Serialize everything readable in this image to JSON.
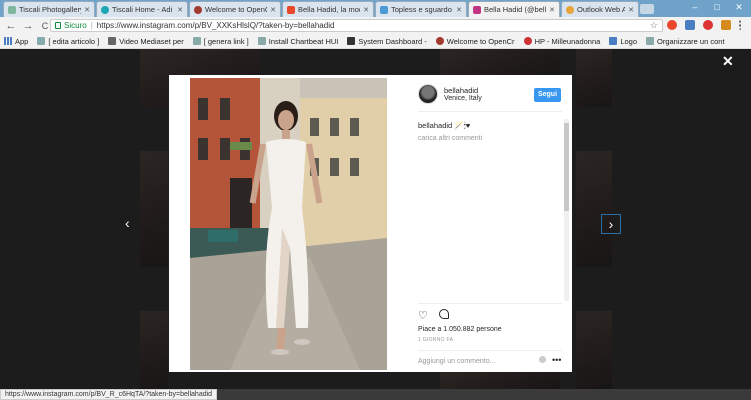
{
  "browser": {
    "tabs": [
      {
        "title": "Tiscali Photogallery",
        "color": "#7fb8a0"
      },
      {
        "title": "Tiscali Home - Adi",
        "color": "#1fa6b5"
      },
      {
        "title": "Welcome to OpenC",
        "color": "#a13a2f"
      },
      {
        "title": "Bella Hadid, la mod",
        "color": "#e8472a"
      },
      {
        "title": "Topless e sguardo",
        "color": "#4a9ad6"
      },
      {
        "title": "Bella Hadid (@bella",
        "color": "#c13584"
      },
      {
        "title": "Outlook Web App",
        "color": "#e8a33a"
      }
    ],
    "toolbar": {
      "back": "←",
      "forward": "→",
      "reload": "C",
      "secure_label": "Sicuro",
      "url_separator": "|",
      "url": "https://www.instagram.com/p/BV_XXKsHlslQ/?taken-by=bellahadid",
      "star": "☆"
    },
    "bookmarks": [
      "App",
      "[ edita articolo ]",
      "Video Mediaset per",
      "[ genera link ]",
      "Install Chartbeat HUI",
      "System Dashboard -",
      "Welcome to OpenCr",
      "HP - Milleunadonna",
      "Logo",
      "Organizzare un cont"
    ],
    "status_url": "https://www.instagram.com/p/BV_R_c6HqTA/?taken-by=bellahadid"
  },
  "post": {
    "username": "bellahadid",
    "location": "Venice, Italy",
    "follow_label": "Segui",
    "caption": "bellahadid 🪄🕯♥",
    "more_comments": "carica altri commenti",
    "likes": "Piace a 1.050.882 persone",
    "date": "1 GIORNO FA",
    "comment_placeholder": "Aggiungi un commento...",
    "options": "•••",
    "heart": "♡"
  },
  "modal": {
    "close": "✕",
    "prev": "‹",
    "next": "›"
  },
  "colors": {
    "follow_button": "#3897f0",
    "secure_green": "#0a8c3a",
    "tabstrip": "#6fa3c9"
  }
}
